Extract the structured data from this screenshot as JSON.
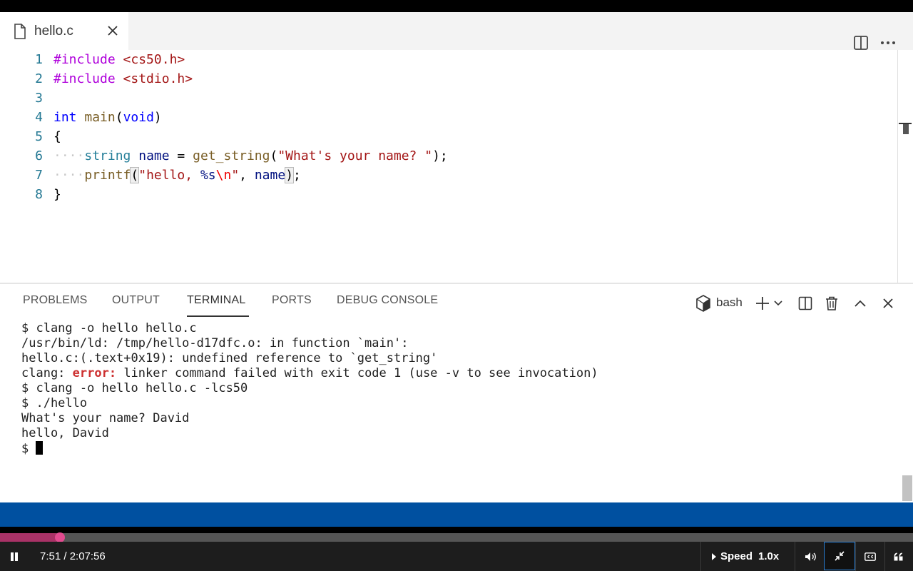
{
  "editor": {
    "tab_label": "hello.c",
    "lines": [
      {
        "n": "1"
      },
      {
        "n": "2"
      },
      {
        "n": "3"
      },
      {
        "n": "4"
      },
      {
        "n": "5"
      },
      {
        "n": "6"
      },
      {
        "n": "7"
      },
      {
        "n": "8"
      }
    ]
  },
  "panel": {
    "tabs": [
      "PROBLEMS",
      "OUTPUT",
      "TERMINAL",
      "PORTS",
      "DEBUG CONSOLE"
    ],
    "active_tab": "TERMINAL",
    "shell": "bash"
  },
  "terminal": {
    "lines": [
      "$ clang -o hello hello.c",
      "/usr/bin/ld: /tmp/hello-d17dfc.o: in function `main':",
      "hello.c:(.text+0x19): undefined reference to `get_string'",
      "clang: ",
      "$ clang -o hello hello.c -lcs50",
      "$ ./hello",
      "What's your name? David",
      "hello, David",
      "$ "
    ],
    "error_word": "error:",
    "error_rest": " linker command failed with exit code 1 (use -v to see invocation)"
  },
  "player": {
    "time": "7:51 / 2:07:56",
    "progress_fraction": 0.0614,
    "speed_label": "Speed",
    "speed_value": "1.0x"
  },
  "colors": {
    "status_bar": "#0050a0",
    "progress": "#a93266",
    "error": "#cd3131"
  }
}
